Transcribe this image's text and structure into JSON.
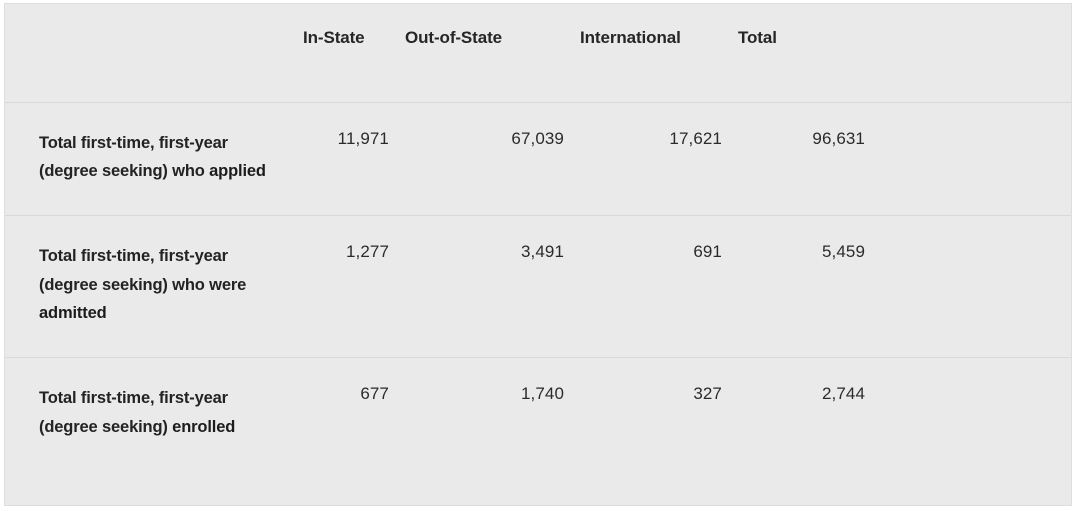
{
  "table": {
    "columns": [
      {
        "key": "label",
        "label": ""
      },
      {
        "key": "in_state",
        "label": "In-State"
      },
      {
        "key": "out_of_state",
        "label": "Out-of-State"
      },
      {
        "key": "international",
        "label": "International"
      },
      {
        "key": "total",
        "label": "Total"
      }
    ],
    "rows": [
      {
        "label_prefix": "Total first-time, first-year (degree seeking) who ",
        "label_emphasis": "applied",
        "label_suffix": "",
        "in_state": "11,971",
        "out_of_state": "67,039",
        "international": "17,621",
        "total": "96,631"
      },
      {
        "label_prefix": "Total first-time, first-year (degree seeking) who were ",
        "label_emphasis": "admitted",
        "label_suffix": "",
        "in_state": "1,277",
        "out_of_state": "3,491",
        "international": "691",
        "total": "5,459"
      },
      {
        "label_prefix": "Total first-time, first-year (degree seeking) ",
        "label_emphasis": "enrolled",
        "label_suffix": "",
        "in_state": "677",
        "out_of_state": "1,740",
        "international": "327",
        "total": "2,744"
      }
    ]
  },
  "colors": {
    "background": "#eaeaea",
    "page": "#ffffff",
    "divider": "#d9d9d9",
    "border": "#dedede",
    "text": "#232323",
    "number_text": "#2b2b2b"
  }
}
